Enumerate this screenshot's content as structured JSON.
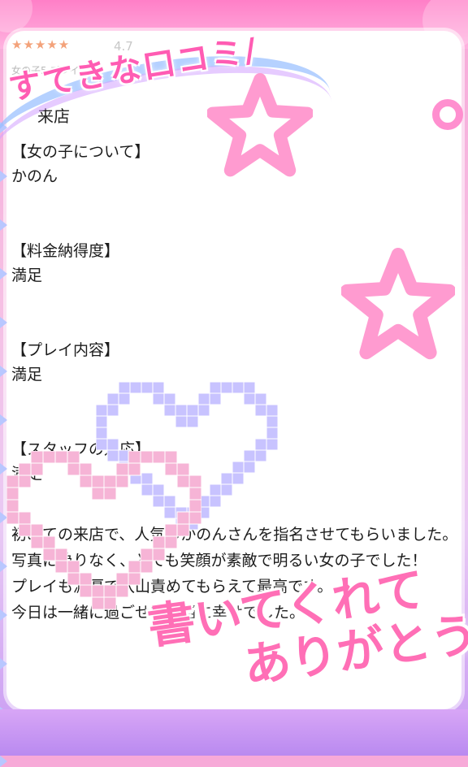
{
  "rating": {
    "stars": "★★★★★",
    "value": "4.7"
  },
  "meta_line": "女の子5 プレイ5 ...",
  "banner": {
    "text": "すてきな口コミ/"
  },
  "visit_title": "来店",
  "sections": [
    {
      "head": "【女の子について】",
      "value": "かのん"
    },
    {
      "head": "【料金納得度】",
      "value": "満足"
    },
    {
      "head": "【プレイ内容】",
      "value": "満足"
    },
    {
      "head": "【スタッフの対応】",
      "value": "満足"
    }
  ],
  "comment": "初めての来店で、人気のかのんさんを指名させてもらいました。\n写真に偽りなく、とても笑顔が素敵で明るい女の子でした！\nプレイも濃厚で沢山責めてもらえて最高です。\n今日は一緒に過ごせて本当に幸せでした。",
  "overlay": {
    "line1": "書いてくれて",
    "line2": "ありがとう"
  },
  "colors": {
    "pink": "#ff5cb3",
    "lavender": "#c8c3ff",
    "heart_pink": "#f6b4d6"
  }
}
